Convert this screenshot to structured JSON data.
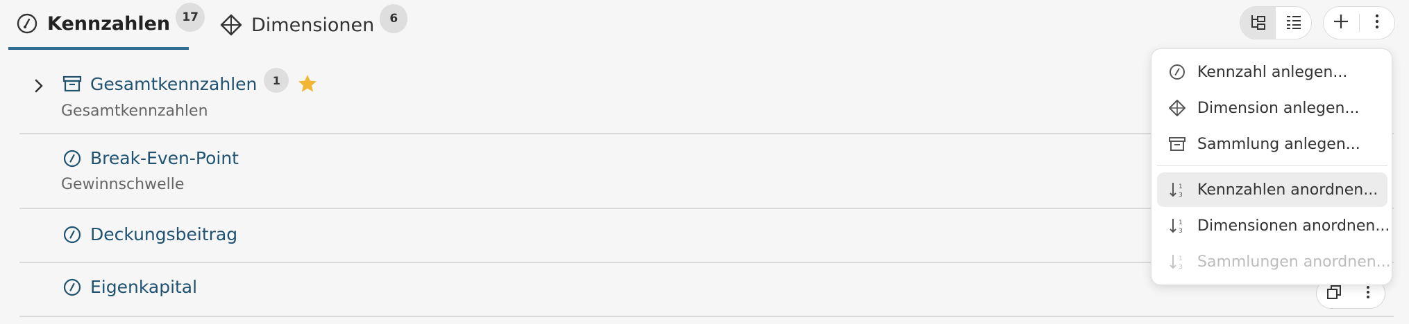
{
  "tabs": [
    {
      "label": "Kennzahlen",
      "count": "17",
      "icon": "gauge-icon",
      "active": true
    },
    {
      "label": "Dimensionen",
      "count": "6",
      "icon": "diamond-icon",
      "active": false
    }
  ],
  "toolbar": {
    "view_toggle": [
      "tree-view-icon",
      "list-view-icon"
    ],
    "add_icon": "plus-icon",
    "more_icon": "more-vertical-icon"
  },
  "rows": [
    {
      "title": "Gesamtkennzahlen",
      "subtitle": "Gesamtkennzahlen",
      "icon": "archive-icon",
      "count": "1",
      "starred": true,
      "expandable": true
    },
    {
      "title": "Break-Even-Point",
      "subtitle": "Gewinnschwelle",
      "icon": "gauge-icon"
    },
    {
      "title": "Deckungsbeitrag",
      "subtitle": "",
      "icon": "gauge-icon"
    },
    {
      "title": "Eigenkapital",
      "subtitle": "",
      "icon": "gauge-icon"
    }
  ],
  "menu": {
    "items": [
      {
        "label": "Kennzahl anlegen...",
        "icon": "gauge-icon"
      },
      {
        "label": "Dimension anlegen...",
        "icon": "diamond-icon"
      },
      {
        "label": "Sammlung anlegen...",
        "icon": "archive-icon"
      },
      {
        "label": "Kennzahlen anordnen...",
        "icon": "sort-icon",
        "hover": true
      },
      {
        "label": "Dimensionen anordnen...",
        "icon": "sort-icon"
      },
      {
        "label": "Sammlungen anordnen...",
        "icon": "sort-icon",
        "disabled": true
      }
    ]
  },
  "colors": {
    "accent": "#2f6d93",
    "title_text": "#1f5170",
    "star": "#f2b632",
    "background": "#f6f6f6"
  }
}
